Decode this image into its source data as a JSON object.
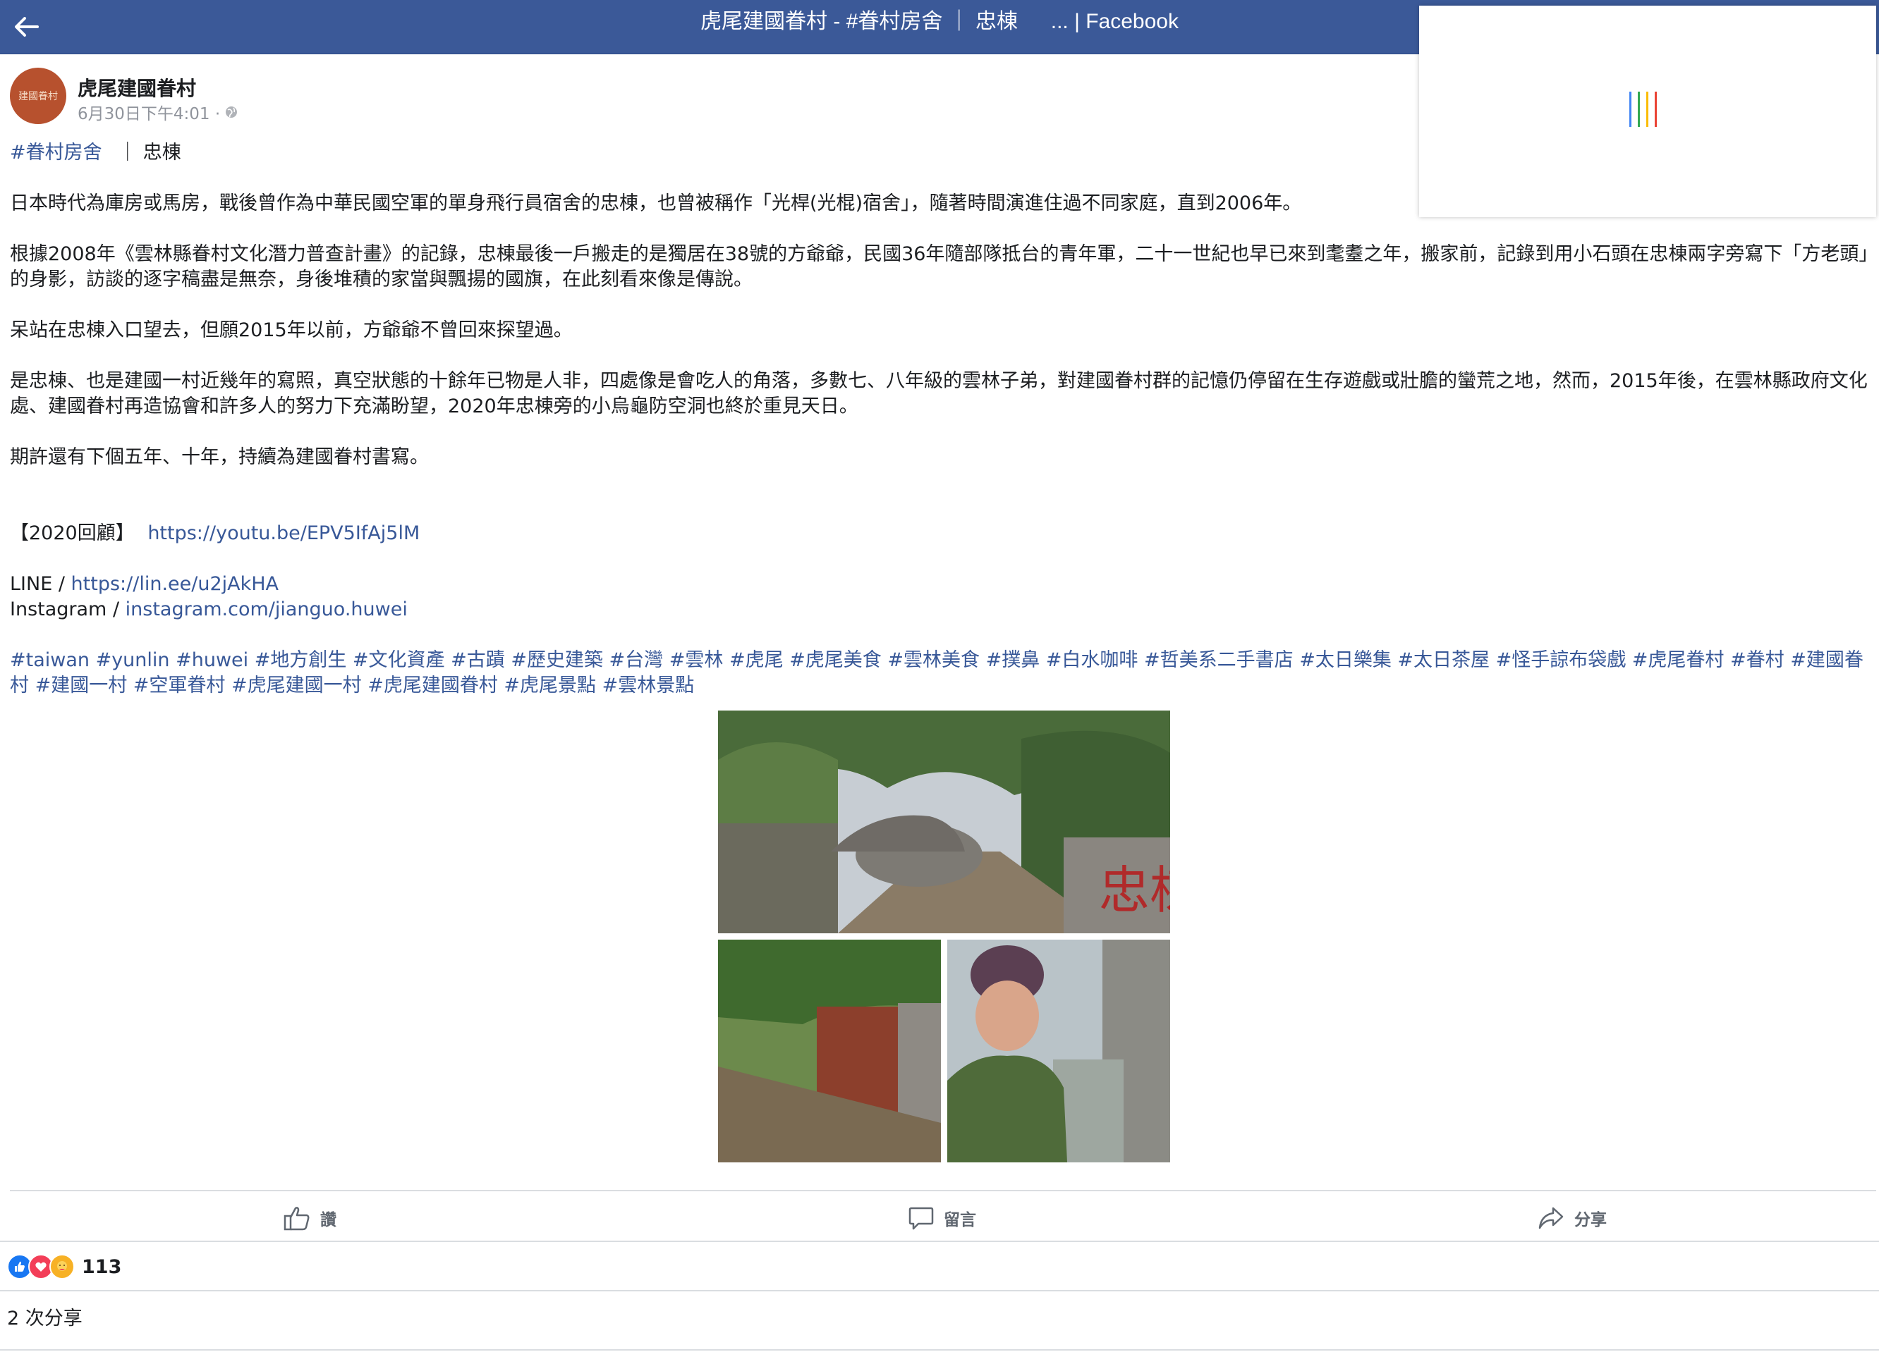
{
  "header": {
    "title": "虎尾建國眷村 - #眷村房舍 ｜ 忠棟 　 ... | Facebook"
  },
  "post": {
    "page_name": "虎尾建國眷村",
    "avatar_text": "建國眷村",
    "timestamp": "6月30日下午4:01 ·",
    "tag_line": {
      "hashtag": "#眷村房舍",
      "rest": "｜ 忠棟"
    },
    "paragraphs": [
      "日本時代為庫房或馬房，戰後曾作為中華民國空軍的單身飛行員宿舍的忠棟，也曾被稱作「光桿(光棍)宿舍」，隨著時間演進住過不同家庭，直到2006年。",
      "根據2008年《雲林縣眷村文化潛力普查計畫》的記錄，忠棟最後一戶搬走的是獨居在38號的方爺爺，民國36年隨部隊抵台的青年軍，二十一世紀也早已來到耄耋之年，搬家前，記錄到用小石頭在忠棟兩字旁寫下「方老頭」的身影，訪談的逐字稿盡是無奈，身後堆積的家當與飄揚的國旗，在此刻看來像是傳說。",
      "呆站在忠棟入口望去，但願2015年以前，方爺爺不曾回來探望過。",
      "是忠棟、也是建國一村近幾年的寫照，真空狀態的十餘年已物是人非，四處像是會吃人的角落，多數七、八年級的雲林子弟，對建國眷村群的記憶仍停留在生存遊戲或壯膽的蠻荒之地，然而，2015年後，在雲林縣政府文化處、建國眷村再造協會和許多人的努力下充滿盼望，2020年忠棟旁的小烏龜防空洞也終於重見天日。",
      "期許還有下個五年、十年，持續為建國眷村書寫。"
    ],
    "review": {
      "label": "【2020回顧】",
      "url": "https://youtu.be/EPV5IfAj5lM"
    },
    "line": {
      "label": "LINE /",
      "url": "https://lin.ee/u2jAkHA"
    },
    "instagram": {
      "label": "Instagram /",
      "url": "instagram.com/jianguo.huwei"
    },
    "hashtags": "#taiwan #yunlin #huwei #地方創生 #文化資產 #古蹟 #歷史建築 #台灣 #雲林 #虎尾 #虎尾美食 #雲林美食 #撲鼻 #白水咖啡 #哲美系二手書店 #太日樂集 #太日茶屋 #怪手諒布袋戲 #虎尾眷村 #眷村 #建國眷村 #建國一村 #空軍眷村 #虎尾建國一村 #虎尾建國眷村 #虎尾景點 #雲林景點",
    "photos": {
      "sign_text": "忠棟"
    }
  },
  "actions": {
    "like": "讚",
    "comment": "留言",
    "share": "分享"
  },
  "stats": {
    "reaction_count": "113",
    "shares": "2 次分享"
  },
  "colors": {
    "header_bg": "#3b5998",
    "link": "#385898",
    "loader": [
      "#4285f4",
      "#34a853",
      "#fbbc05",
      "#ea4335"
    ]
  }
}
